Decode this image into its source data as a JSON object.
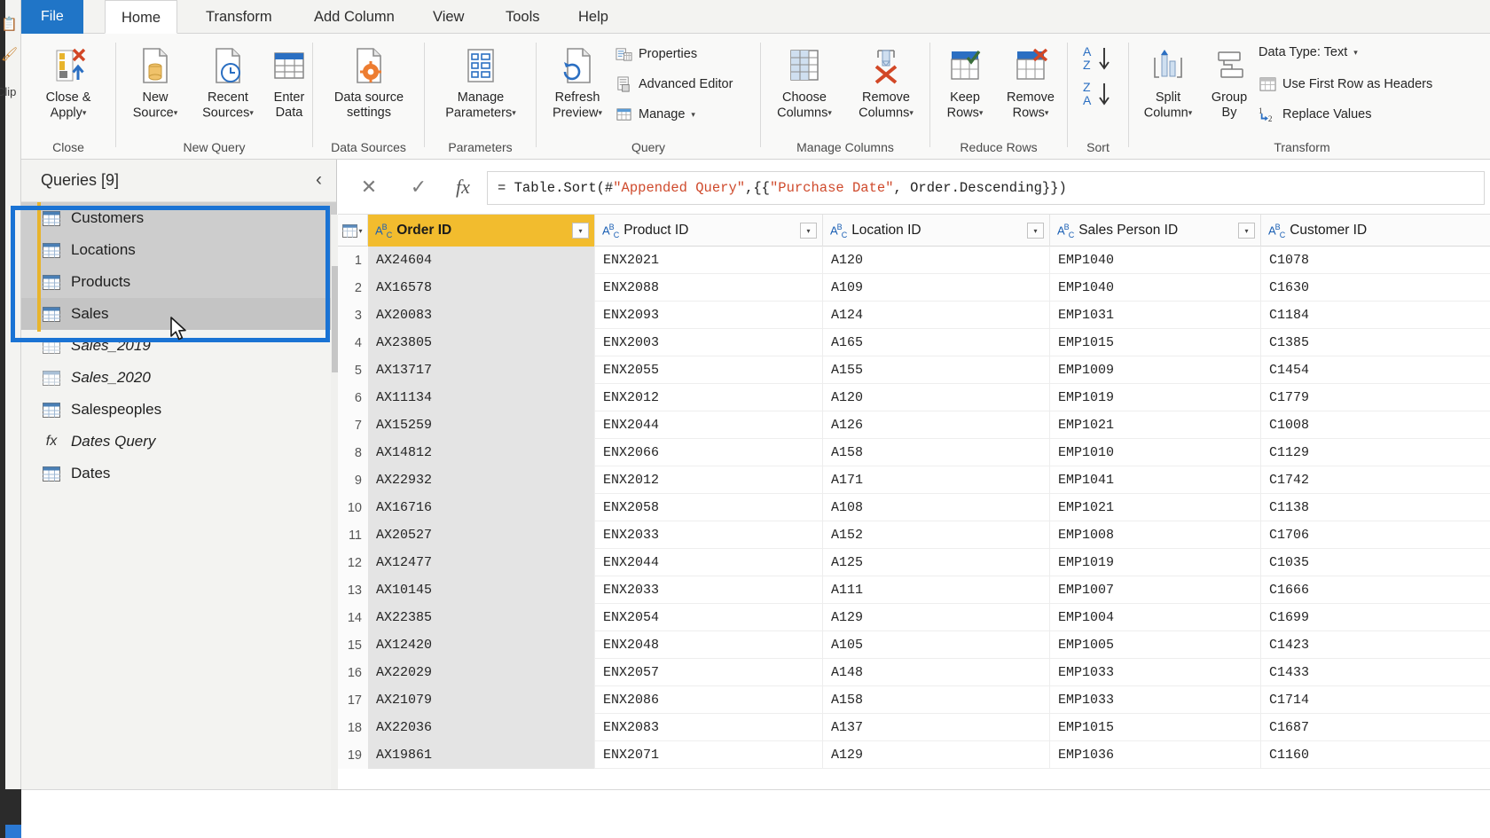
{
  "window": {
    "clipboard_group_label": "Clip"
  },
  "ribbon": {
    "tabs": [
      {
        "label": "File",
        "state": "file"
      },
      {
        "label": "Home",
        "state": "active"
      },
      {
        "label": "Transform",
        "state": "normal"
      },
      {
        "label": "Add Column",
        "state": "normal"
      },
      {
        "label": "View",
        "state": "normal"
      },
      {
        "label": "Tools",
        "state": "normal"
      },
      {
        "label": "Help",
        "state": "normal"
      }
    ],
    "groups": [
      {
        "name": "close",
        "title": "Close"
      },
      {
        "name": "new-query",
        "title": "New Query"
      },
      {
        "name": "data-sources",
        "title": "Data Sources"
      },
      {
        "name": "parameters",
        "title": "Parameters"
      },
      {
        "name": "query",
        "title": "Query"
      },
      {
        "name": "manage-columns",
        "title": "Manage Columns"
      },
      {
        "name": "reduce-rows",
        "title": "Reduce Rows"
      },
      {
        "name": "sort",
        "title": "Sort"
      },
      {
        "name": "transform",
        "title": "Transform"
      }
    ],
    "buttons": {
      "close_apply": {
        "line1": "Close &",
        "line2": "Apply",
        "caret": "▾"
      },
      "new_source": {
        "line1": "New",
        "line2": "Source",
        "caret": "▾"
      },
      "recent_sources": {
        "line1": "Recent",
        "line2": "Sources",
        "caret": "▾"
      },
      "enter_data": {
        "line1": "Enter",
        "line2": "Data",
        "caret": ""
      },
      "data_source_settings": {
        "line1": "Data source",
        "line2": "settings",
        "caret": ""
      },
      "manage_parameters": {
        "line1": "Manage",
        "line2": "Parameters",
        "caret": "▾"
      },
      "refresh_preview": {
        "line1": "Refresh",
        "line2": "Preview",
        "caret": "▾"
      },
      "properties": {
        "label": "Properties"
      },
      "advanced_editor": {
        "label": "Advanced Editor"
      },
      "manage": {
        "label": "Manage",
        "caret": "▾"
      },
      "choose_columns": {
        "line1": "Choose",
        "line2": "Columns",
        "caret": "▾"
      },
      "remove_columns": {
        "line1": "Remove",
        "line2": "Columns",
        "caret": "▾"
      },
      "keep_rows": {
        "line1": "Keep",
        "line2": "Rows",
        "caret": "▾"
      },
      "remove_rows": {
        "line1": "Remove",
        "line2": "Rows",
        "caret": "▾"
      },
      "sort_asc": {
        "label": "A↓Z"
      },
      "sort_desc": {
        "label": "Z↓A"
      },
      "split_column": {
        "line1": "Split",
        "line2": "Column",
        "caret": "▾"
      },
      "group_by": {
        "line1": "Group",
        "line2": "By",
        "caret": ""
      },
      "data_type": {
        "label": "Data Type: Text",
        "caret": "▾"
      },
      "use_first_row": {
        "label": "Use First Row as Headers"
      },
      "replace_values": {
        "label": "Replace Values"
      }
    }
  },
  "queries_pane": {
    "title": "Queries [9]",
    "collapse_icon": "‹",
    "items": [
      {
        "label": "Customers",
        "icon": "table",
        "italic": false,
        "group_selected": true,
        "hover": false
      },
      {
        "label": "Locations",
        "icon": "table",
        "italic": false,
        "group_selected": true,
        "hover": false
      },
      {
        "label": "Products",
        "icon": "table",
        "italic": false,
        "group_selected": true,
        "hover": false
      },
      {
        "label": "Sales",
        "icon": "table",
        "italic": false,
        "group_selected": true,
        "hover": true
      },
      {
        "label": "Sales_2019",
        "icon": "table",
        "italic": true,
        "group_selected": false,
        "hover": false
      },
      {
        "label": "Sales_2020",
        "icon": "table",
        "italic": true,
        "group_selected": false,
        "hover": false
      },
      {
        "label": "Salespeoples",
        "icon": "table",
        "italic": false,
        "group_selected": false,
        "hover": false
      },
      {
        "label": "Dates Query",
        "icon": "fx",
        "italic": true,
        "group_selected": false,
        "hover": false
      },
      {
        "label": "Dates",
        "icon": "table",
        "italic": false,
        "group_selected": false,
        "hover": false
      }
    ]
  },
  "formula_bar": {
    "cancel_icon": "✕",
    "accept_icon": "✓",
    "fx_icon": "fx",
    "prefix": "= Table.Sort(#",
    "arg_quoted": "\"Appended Query\"",
    "middle": ",{{",
    "sort_key": "\"Purchase Date\"",
    "suffix": ", Order.Descending}})",
    "full_text": "= Table.Sort(#\"Appended Query\",{{\"Purchase Date\", Order.Descending}})"
  },
  "grid": {
    "columns": [
      {
        "name": "Order ID",
        "type_icon": "ABC",
        "selected": true,
        "has_filter": true
      },
      {
        "name": "Product ID",
        "type_icon": "ABC",
        "selected": false,
        "has_filter": true
      },
      {
        "name": "Location ID",
        "type_icon": "ABC",
        "selected": false,
        "has_filter": true
      },
      {
        "name": "Sales Person ID",
        "type_icon": "ABC",
        "selected": false,
        "has_filter": true
      },
      {
        "name": "Customer ID",
        "type_icon": "ABC",
        "selected": false,
        "has_filter": false
      }
    ],
    "rows": [
      {
        "n": "1",
        "cells": [
          "AX24604",
          "ENX2021",
          "A120",
          "EMP1040",
          "C1078"
        ]
      },
      {
        "n": "2",
        "cells": [
          "AX16578",
          "ENX2088",
          "A109",
          "EMP1040",
          "C1630"
        ]
      },
      {
        "n": "3",
        "cells": [
          "AX20083",
          "ENX2093",
          "A124",
          "EMP1031",
          "C1184"
        ]
      },
      {
        "n": "4",
        "cells": [
          "AX23805",
          "ENX2003",
          "A165",
          "EMP1015",
          "C1385"
        ]
      },
      {
        "n": "5",
        "cells": [
          "AX13717",
          "ENX2055",
          "A155",
          "EMP1009",
          "C1454"
        ]
      },
      {
        "n": "6",
        "cells": [
          "AX11134",
          "ENX2012",
          "A120",
          "EMP1019",
          "C1779"
        ]
      },
      {
        "n": "7",
        "cells": [
          "AX15259",
          "ENX2044",
          "A126",
          "EMP1021",
          "C1008"
        ]
      },
      {
        "n": "8",
        "cells": [
          "AX14812",
          "ENX2066",
          "A158",
          "EMP1010",
          "C1129"
        ]
      },
      {
        "n": "9",
        "cells": [
          "AX22932",
          "ENX2012",
          "A171",
          "EMP1041",
          "C1742"
        ]
      },
      {
        "n": "10",
        "cells": [
          "AX16716",
          "ENX2058",
          "A108",
          "EMP1021",
          "C1138"
        ]
      },
      {
        "n": "11",
        "cells": [
          "AX20527",
          "ENX2033",
          "A152",
          "EMP1008",
          "C1706"
        ]
      },
      {
        "n": "12",
        "cells": [
          "AX12477",
          "ENX2044",
          "A125",
          "EMP1019",
          "C1035"
        ]
      },
      {
        "n": "13",
        "cells": [
          "AX10145",
          "ENX2033",
          "A111",
          "EMP1007",
          "C1666"
        ]
      },
      {
        "n": "14",
        "cells": [
          "AX22385",
          "ENX2054",
          "A129",
          "EMP1004",
          "C1699"
        ]
      },
      {
        "n": "15",
        "cells": [
          "AX12420",
          "ENX2048",
          "A105",
          "EMP1005",
          "C1423"
        ]
      },
      {
        "n": "16",
        "cells": [
          "AX22029",
          "ENX2057",
          "A148",
          "EMP1033",
          "C1433"
        ]
      },
      {
        "n": "17",
        "cells": [
          "AX21079",
          "ENX2086",
          "A158",
          "EMP1033",
          "C1714"
        ]
      },
      {
        "n": "18",
        "cells": [
          "AX22036",
          "ENX2083",
          "A137",
          "EMP1015",
          "C1687"
        ]
      },
      {
        "n": "19",
        "cells": [
          "AX19861",
          "ENX2071",
          "A129",
          "EMP1036",
          "C1160"
        ]
      }
    ]
  },
  "colors": {
    "file_tab_blue": "#2075c7",
    "selection_box_blue": "#1a73d4",
    "selected_column_header": "#f2bc2e",
    "selected_query_accent": "#e8b42c",
    "accent_orange": "#ed7d31",
    "icon_blue": "#3a7ebf"
  }
}
